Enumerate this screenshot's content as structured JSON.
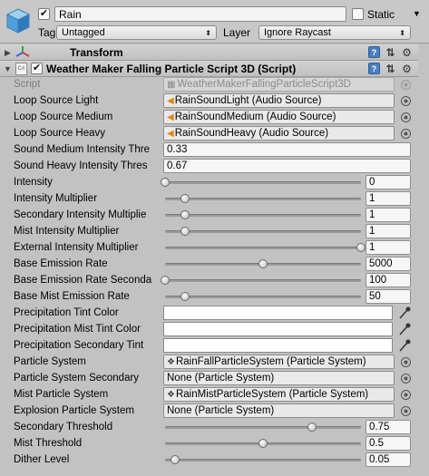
{
  "gameobject": {
    "active": true,
    "name": "Rain",
    "static_label": "Static",
    "static_checked": false,
    "tag_label": "Tag",
    "tag_value": "Untagged",
    "layer_label": "Layer",
    "layer_value": "Ignore Raycast"
  },
  "components": {
    "transform": {
      "title": "Transform",
      "expanded": false
    },
    "weather": {
      "title": "Weather Maker Falling Particle Script 3D (Script)",
      "enabled": true,
      "expanded": true
    }
  },
  "properties": {
    "script": {
      "label": "Script",
      "value": "WeatherMakerFallingParticleScript3D"
    },
    "loop_light": {
      "label": "Loop Source Light",
      "value": "RainSoundLight (Audio Source)"
    },
    "loop_medium": {
      "label": "Loop Source Medium",
      "value": "RainSoundMedium (Audio Source)"
    },
    "loop_heavy": {
      "label": "Loop Source Heavy",
      "value": "RainSoundHeavy (Audio Source)"
    },
    "sound_medium_threshold": {
      "label": "Sound Medium Intensity Thre",
      "value": "0.33"
    },
    "sound_heavy_threshold": {
      "label": "Sound Heavy Intensity Thres",
      "value": "0.67"
    },
    "intensity": {
      "label": "Intensity",
      "value": "0",
      "fraction": 0.0
    },
    "intensity_multiplier": {
      "label": "Intensity Multiplier",
      "value": "1",
      "fraction": 0.1
    },
    "secondary_intensity_multiplier": {
      "label": "Secondary Intensity Multiplie",
      "value": "1",
      "fraction": 0.1
    },
    "mist_intensity_multiplier": {
      "label": "Mist Intensity Multiplier",
      "value": "1",
      "fraction": 0.1
    },
    "external_intensity_multiplier": {
      "label": "External Intensity Multiplier",
      "value": "1",
      "fraction": 1.0
    },
    "base_emission_rate": {
      "label": "Base Emission Rate",
      "value": "5000",
      "fraction": 0.5
    },
    "base_emission_rate_secondary": {
      "label": "Base Emission Rate Seconda",
      "value": "100",
      "fraction": 0.0
    },
    "base_mist_emission_rate": {
      "label": "Base Mist Emission Rate",
      "value": "50",
      "fraction": 0.1
    },
    "precip_tint": {
      "label": "Precipitation Tint Color",
      "color": "#ffffff"
    },
    "precip_mist_tint": {
      "label": "Precipitation Mist Tint Color",
      "color": "#ffffff"
    },
    "precip_secondary_tint": {
      "label": "Precipitation Secondary Tint",
      "color": "#ffffff"
    },
    "particle_system": {
      "label": "Particle System",
      "value": "RainFallParticleSystem (Particle System)"
    },
    "particle_system_secondary": {
      "label": "Particle System Secondary",
      "value": "None (Particle System)"
    },
    "mist_particle_system": {
      "label": "Mist Particle System",
      "value": "RainMistParticleSystem (Particle System)"
    },
    "explosion_particle_system": {
      "label": "Explosion Particle System",
      "value": "None (Particle System)"
    },
    "secondary_threshold": {
      "label": "Secondary Threshold",
      "value": "0.75",
      "fraction": 0.75
    },
    "mist_threshold": {
      "label": "Mist Threshold",
      "value": "0.5",
      "fraction": 0.5
    },
    "dither_level": {
      "label": "Dither Level",
      "value": "0.05",
      "fraction": 0.05
    }
  },
  "icons": {
    "gameobject": "cube-icon",
    "transform": "transform-axes-icon",
    "script": "cs-script-icon",
    "help": "help-icon",
    "preset": "preset-icon",
    "settings": "gear-icon",
    "audio": "audio-source-icon",
    "particle": "particle-system-icon",
    "eyedropper": "eyedropper-icon",
    "picker": "object-picker-icon"
  },
  "colors": {
    "background": "#c2c2c2",
    "help_blue": "#4a7fc0",
    "audio_orange": "#e08a1a"
  }
}
